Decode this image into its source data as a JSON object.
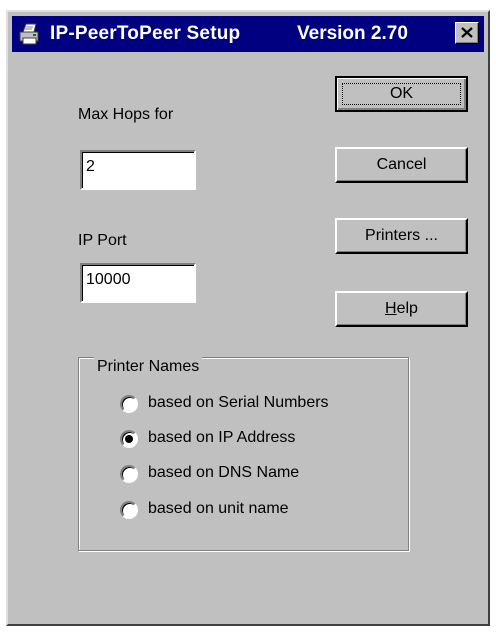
{
  "window": {
    "title": "IP-PeerToPeer Setup",
    "version": "Version 2.70",
    "close_icon": "close-icon",
    "app_icon": "printer-icon"
  },
  "fields": {
    "max_hops_label": "Max Hops for",
    "max_hops_value": "2",
    "ip_port_label": "IP Port",
    "ip_port_value": "10000"
  },
  "buttons": {
    "ok": "OK",
    "cancel": "Cancel",
    "printers": "Printers ...",
    "help": "Help",
    "help_mnemonic": "H",
    "help_rest": "elp"
  },
  "printer_names": {
    "title": "Printer Names",
    "options": [
      {
        "label": "based on Serial Numbers",
        "selected": false
      },
      {
        "label": "based on IP Address",
        "selected": true
      },
      {
        "label": "based on DNS Name",
        "selected": false
      },
      {
        "label": "based on unit name",
        "selected": false
      }
    ]
  },
  "colors": {
    "titlebar": "#000080",
    "face": "#c0c0c0"
  }
}
